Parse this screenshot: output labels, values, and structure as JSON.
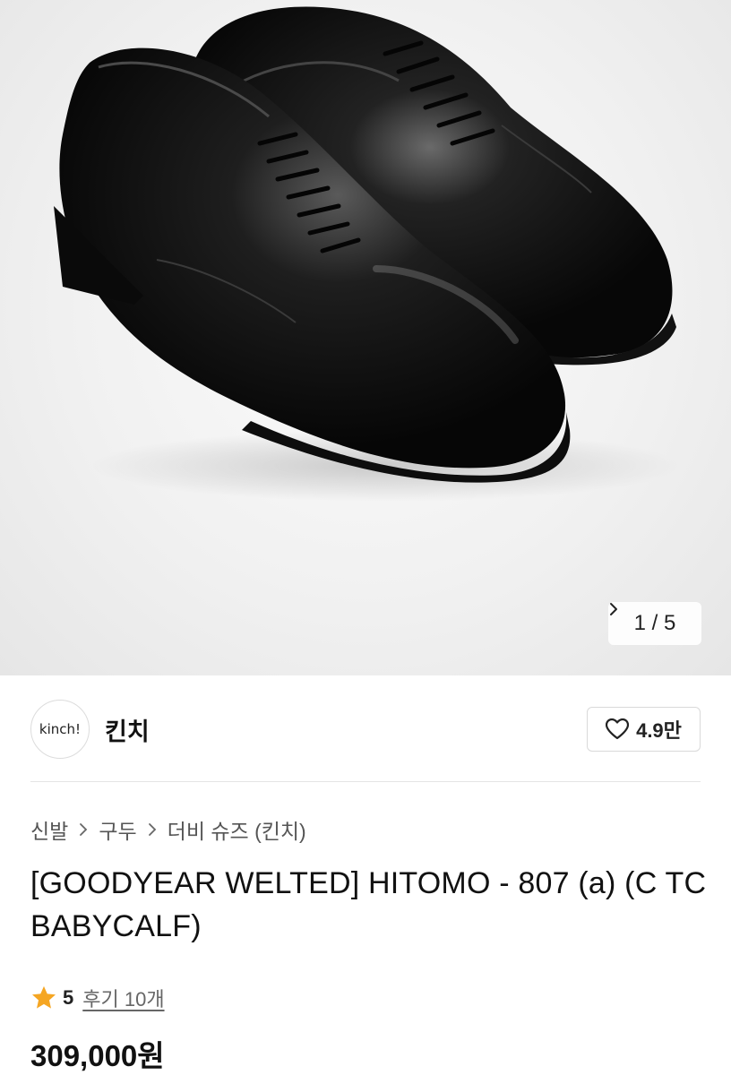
{
  "gallery": {
    "image_alt": "black leather derby shoes pair",
    "counter": "1 / 5",
    "next_icon": "chevron-right-icon"
  },
  "store": {
    "logo_text": "kinch!",
    "name": "킨치",
    "like_icon": "heart-outline-icon",
    "like_count": "4.9만"
  },
  "breadcrumb": [
    "신발",
    "구두",
    "더비 슈즈 (킨치)"
  ],
  "product": {
    "title": "[GOODYEAR WELTED] HITOMO - 807 (a) (C TC BABYCALF)",
    "rating": "5",
    "rating_icon": "star-icon",
    "rating_color": "#F5A623",
    "review_label": "후기 10개",
    "price": "309,000원"
  }
}
